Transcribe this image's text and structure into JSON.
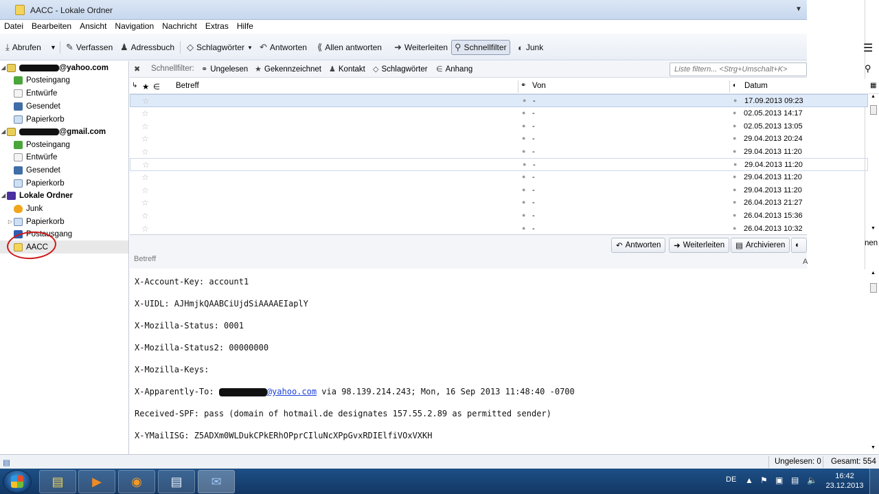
{
  "window": {
    "title": "AACC - Lokale Ordner"
  },
  "menu": [
    "Datei",
    "Bearbeiten",
    "Ansicht",
    "Navigation",
    "Nachricht",
    "Extras",
    "Hilfe"
  ],
  "toolbar": {
    "get": "Abrufen",
    "write": "Verfassen",
    "addressbook": "Adressbuch",
    "tags": "Schlagwörter",
    "reply": "Antworten",
    "reply_all": "Allen antworten",
    "forward": "Weiterleiten",
    "quickfilter": "Schnellfilter",
    "junk": "Junk"
  },
  "folders": {
    "account1_suffix": "@yahoo.com",
    "account2_suffix": "@gmail.com",
    "account1": [
      "Posteingang",
      "Entwürfe",
      "Gesendet",
      "Papierkorb"
    ],
    "account2": [
      "Posteingang",
      "Entwürfe",
      "Gesendet",
      "Papierkorb"
    ],
    "local": "Lokale Ordner",
    "local_items": [
      "Junk",
      "Papierkorb",
      "Postausgang",
      "AACC"
    ]
  },
  "quickfilter": {
    "label": "Schnellfilter:",
    "unread": "Ungelesen",
    "starred": "Gekennzeichnet",
    "contact": "Kontakt",
    "tags": "Schlagwörter",
    "attachment": "Anhang",
    "search_placeholder": "Liste filtern... <Strg+Umschalt+K>"
  },
  "columns": {
    "subject": "Betreff",
    "from": "Von",
    "date": "Datum"
  },
  "messages": [
    {
      "from": "-",
      "date": "17.09.2013 09:23"
    },
    {
      "from": "-",
      "date": "02.05.2013 14:17"
    },
    {
      "from": "-",
      "date": "02.05.2013 13:05"
    },
    {
      "from": "-",
      "date": "29.04.2013 20:24"
    },
    {
      "from": "-",
      "date": "29.04.2013 11:20"
    },
    {
      "from": "-",
      "date": "29.04.2013 11:20"
    },
    {
      "from": "-",
      "date": "29.04.2013 11:20"
    },
    {
      "from": "-",
      "date": "29.04.2013 11:20"
    },
    {
      "from": "-",
      "date": "26.04.2013 21:27"
    },
    {
      "from": "-",
      "date": "26.04.2013 15:36"
    },
    {
      "from": "-",
      "date": "26.04.2013 10:32"
    }
  ],
  "header_buttons": {
    "reply": "Antworten",
    "forward": "Weiterleiten",
    "archive": "Archivieren",
    "subject_label": "Betreff",
    "right_fragment": "nen",
    "a_fragment": "A"
  },
  "body": {
    "line1": "X-Account-Key: account1",
    "line2": "X-UIDL: AJHmjkQAABCiUjdSiAAAAEIaplY",
    "line3": "X-Mozilla-Status: 0001",
    "line4": "X-Mozilla-Status2: 00000000",
    "line5": "X-Mozilla-Keys:",
    "line6_prefix": "X-Apparently-To: ",
    "line6_link": "@yahoo.com",
    "line6_suffix": " via 98.139.214.243; Mon, 16 Sep 2013 11:48:40 -0700",
    "line7": "Received-SPF: pass (domain of hotmail.de designates 157.55.2.89 as permitted sender)",
    "line8": "X-YMailISG: Z5ADXm0WLDukCPkERhOPprCIluNcXPpGvxRDIElfiVOxVXKH"
  },
  "status": {
    "unread": "Ungelesen: 0",
    "total": "Gesamt: 554"
  },
  "taskbar": {
    "lang": "DE",
    "time": "16:42",
    "date": "23.12.2013"
  }
}
